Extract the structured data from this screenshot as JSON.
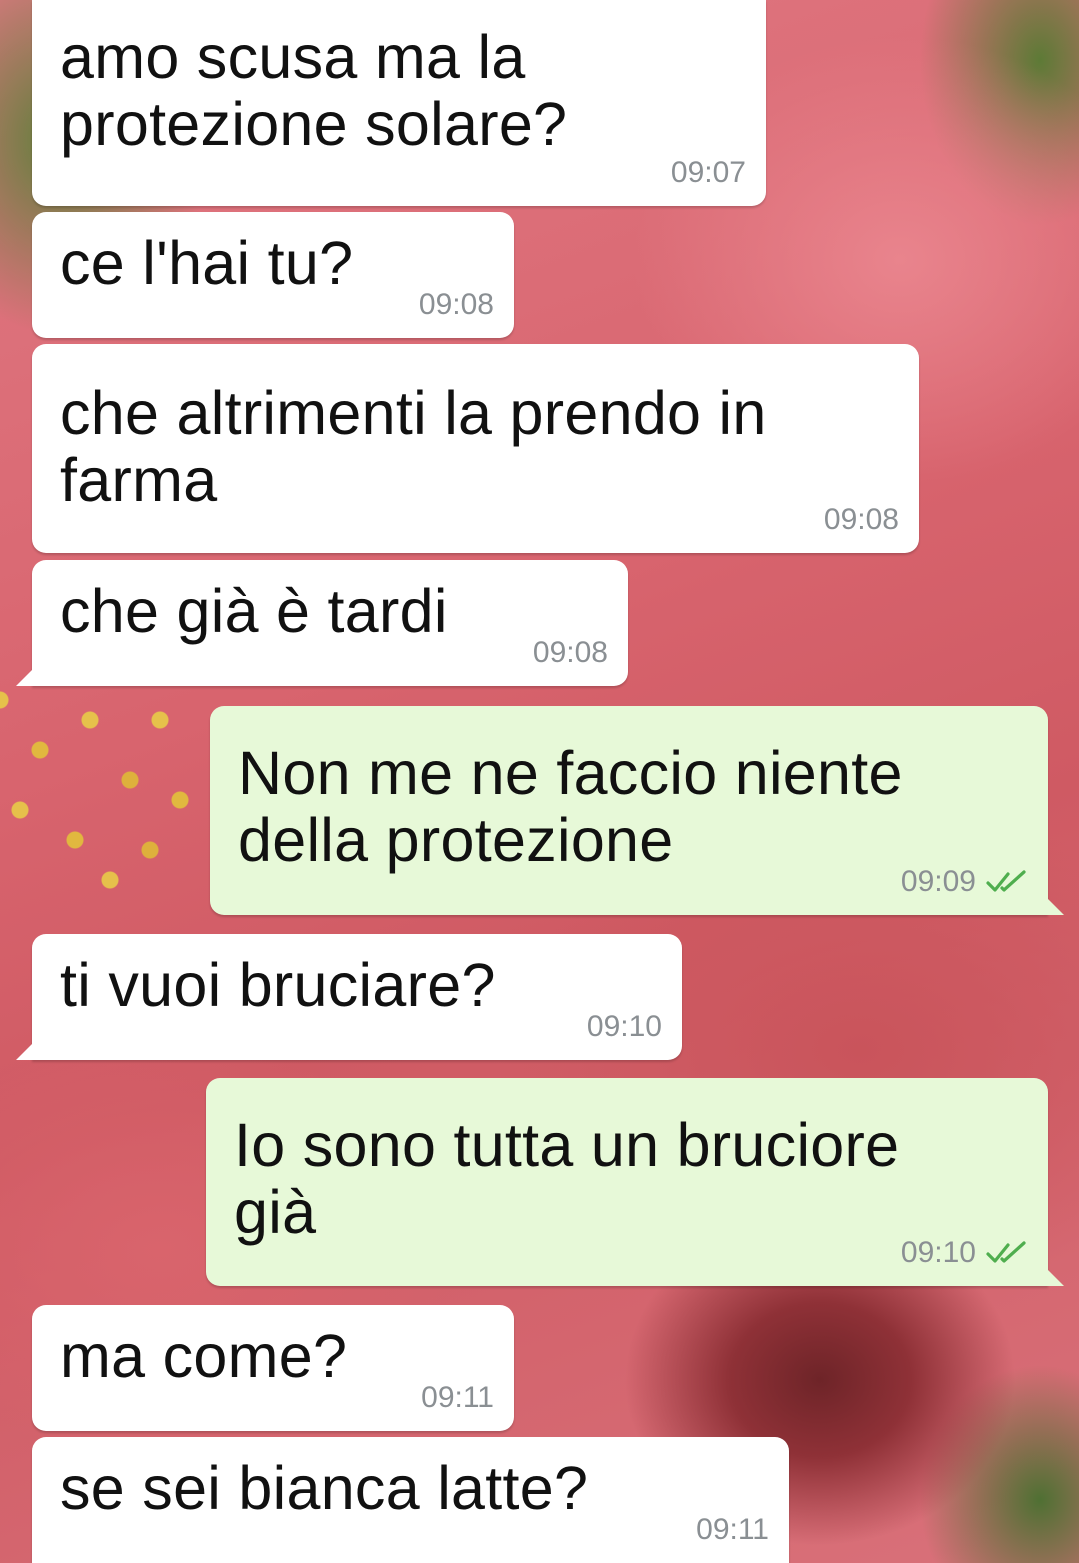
{
  "conversation": {
    "messages": [
      {
        "direction": "in",
        "text": "amo scusa ma la\nprotezione solare?",
        "time": "09:07"
      },
      {
        "direction": "in",
        "text": "ce l'hai tu?",
        "time": "09:08"
      },
      {
        "direction": "in",
        "text": "che altrimenti la prendo in\nfarma",
        "time": "09:08"
      },
      {
        "direction": "in",
        "text": "che già è tardi",
        "time": "09:08"
      },
      {
        "direction": "out",
        "text": "Non me ne faccio niente\ndella protezione",
        "time": "09:09",
        "status_icon": "double-check-icon"
      },
      {
        "direction": "in",
        "text": "ti vuoi bruciare?",
        "time": "09:10"
      },
      {
        "direction": "out",
        "text": "Io sono tutta un bruciore\ngià",
        "time": "09:10",
        "status_icon": "double-check-icon"
      },
      {
        "direction": "in",
        "text": "ma come?",
        "time": "09:11"
      },
      {
        "direction": "in",
        "text": "se sei bianca latte?",
        "time": "09:11"
      }
    ]
  },
  "colors": {
    "incoming_bubble": "#ffffff",
    "outgoing_bubble": "#e7f9d8",
    "timestamp": "#8a8f93",
    "read_check": "#4fae4e"
  }
}
